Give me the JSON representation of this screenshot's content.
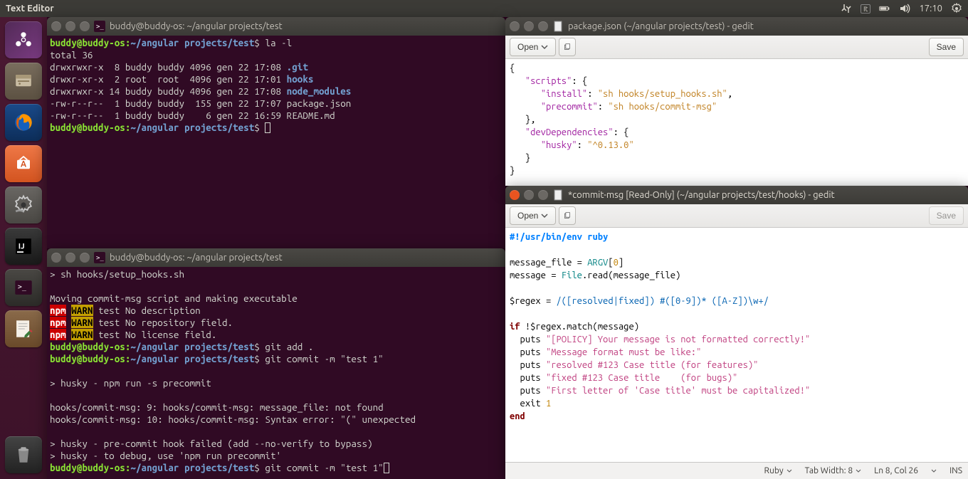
{
  "panel": {
    "title": "Text Editor",
    "lang": "It",
    "time": "17:10"
  },
  "windows": {
    "term1": {
      "title": "buddy@buddy-os: ~/angular projects/test",
      "prompt_user": "buddy@buddy-os",
      "prompt_path": "~/angular projects/test",
      "cmd1": "la -l",
      "out_total": "total 36",
      "row_git": "drwxrwxr-x  8 buddy buddy 4096 gen 22 17:08 ",
      "name_git": ".git",
      "row_hooks": "drwxr-xr-x  2 root  root  4096 gen 22 17:01 ",
      "name_hooks": "hooks",
      "row_nm": "drwxrwxr-x 14 buddy buddy 4096 gen 22 17:08 ",
      "name_nm": "node_modules",
      "row_pkg": "-rw-r--r--  1 buddy buddy  155 gen 22 17:07 package.json",
      "row_readme": "-rw-r--r--  1 buddy buddy    6 gen 22 16:59 README.md"
    },
    "term2": {
      "title": "buddy@buddy-os: ~/angular projects/test",
      "l1": "> sh hooks/setup_hooks.sh",
      "l2": "Moving commit-msg script and making executable",
      "npm": "npm",
      "warn": "WARN",
      "w1": " test No description",
      "w2": " test No repository field.",
      "w3": " test No license field.",
      "cmd_add": "git add .",
      "cmd_commit": "git commit -m \"test 1\"",
      "husky1": "> husky - npm run -s precommit",
      "err1": "hooks/commit-msg: 9: hooks/commit-msg: message_file: not found",
      "err2": "hooks/commit-msg: 10: hooks/commit-msg: Syntax error: \"(\" unexpected",
      "husky2": "> husky - pre-commit hook failed (add --no-verify to bypass)",
      "husky3": "> husky - to debug, use 'npm run precommit'",
      "cmd_commit2": "git commit -m \"test 1\""
    },
    "gedit1": {
      "title": "package.json (~/angular projects/test) - gedit",
      "open": "Open",
      "save": "Save",
      "k_scripts": "\"scripts\"",
      "k_install": "\"install\"",
      "v_install": "\"sh hooks/setup_hooks.sh\"",
      "k_precommit": "\"precommit\"",
      "v_precommit": "\"sh hooks/commit-msg\"",
      "k_devdep": "\"devDependencies\"",
      "k_husky": "\"husky\"",
      "v_husky": "\"^0.13.0\""
    },
    "gedit2": {
      "title": "*commit-msg [Read-Only] (~/angular projects/test/hooks) - gedit",
      "open": "Open",
      "save": "Save",
      "shebang": "#!/usr/bin/env ruby",
      "l_argv": "ARGV",
      "l_zero": "0",
      "l_file": "File",
      "regex": "/([resolved|fixed]) #([0-9])* ([A-Z])\\w+/",
      "s1": "\"[POLICY] Your message is not formatted correctly!\"",
      "s2": "\"Message format must be like:\"",
      "s3": "\"resolved #123 Case title (for features)\"",
      "s4": "\"fixed #123 Case title    (for bugs)\"",
      "s5": "\"First letter of 'Case title' must be capitalized!\"",
      "one": "1",
      "status": {
        "lang": "Ruby",
        "tabw": "Tab Width: 8",
        "pos": "Ln 8, Col 26",
        "ins": "INS"
      }
    }
  }
}
